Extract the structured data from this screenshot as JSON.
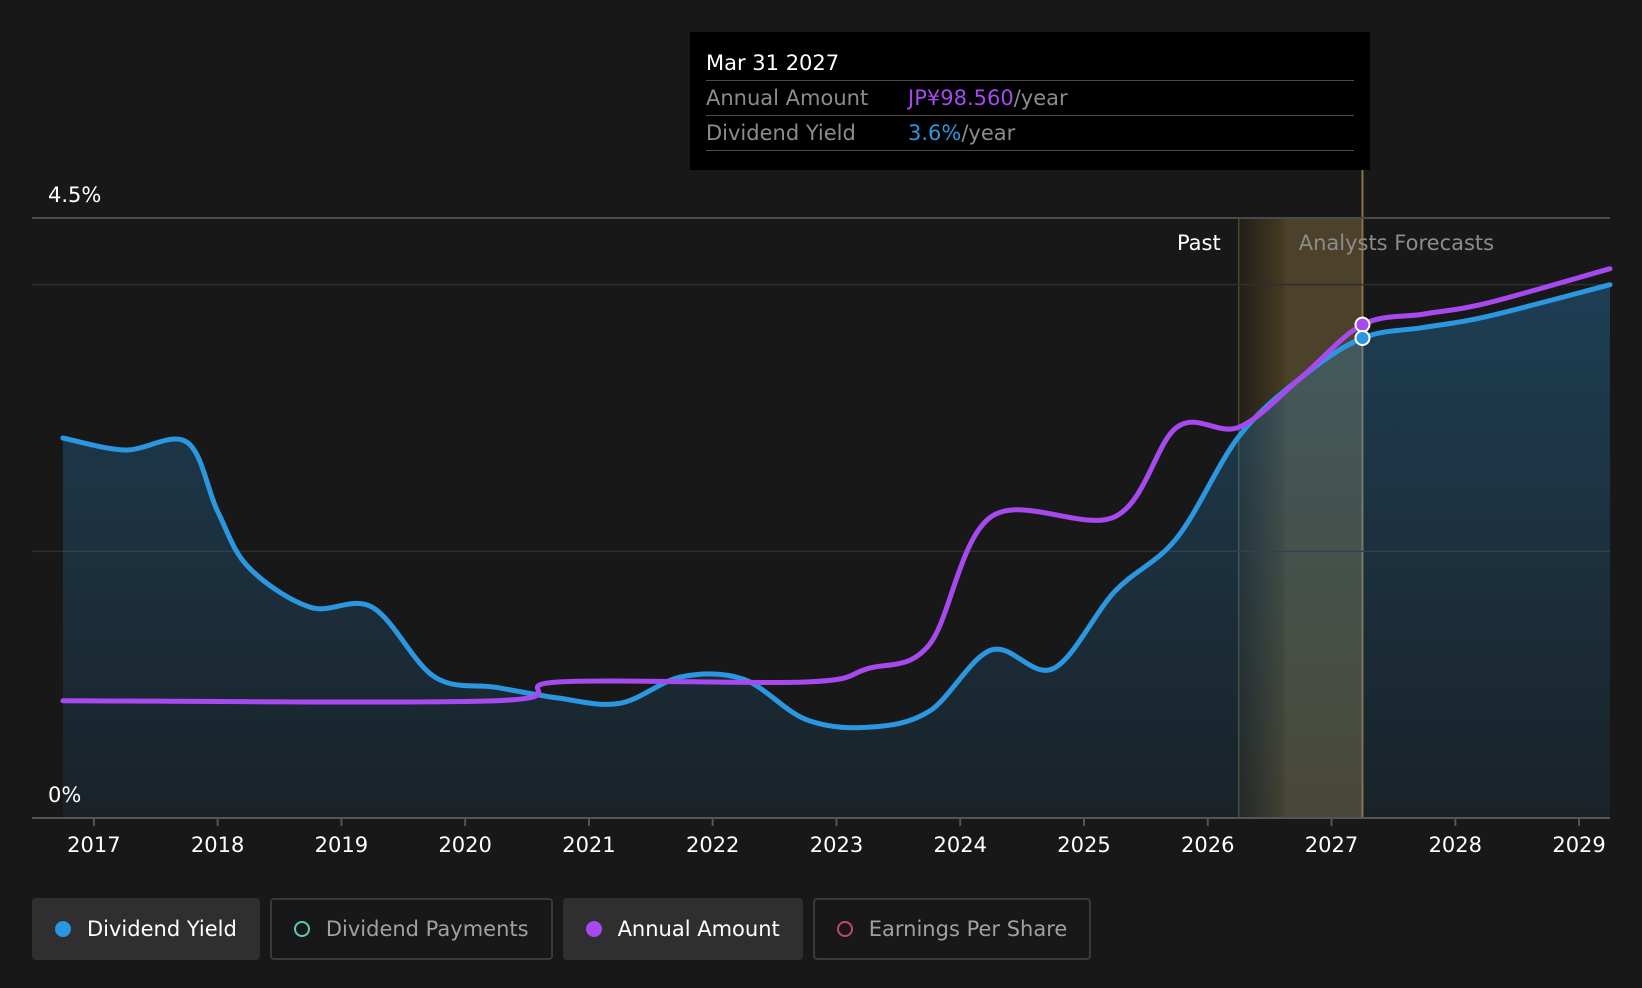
{
  "tooltip": {
    "date": "Mar 31 2027",
    "rows": [
      {
        "label": "Annual Amount",
        "value": "JP¥98.560",
        "unit": "/year",
        "color": "#a64af0"
      },
      {
        "label": "Dividend Yield",
        "value": "3.6%",
        "unit": "/year",
        "color": "#2b97e0"
      }
    ]
  },
  "legend": [
    {
      "label": "Dividend Yield",
      "color": "#2b97e0",
      "filled": true,
      "active": true
    },
    {
      "label": "Dividend Payments",
      "color": "#5fc8b8",
      "filled": false,
      "active": false
    },
    {
      "label": "Annual Amount",
      "color": "#a64af0",
      "filled": true,
      "active": true
    },
    {
      "label": "Earnings Per Share",
      "color": "#c0457a",
      "filled": false,
      "active": false
    }
  ],
  "chart_data": {
    "type": "line",
    "title": "",
    "xlabel": "",
    "ylabel": "",
    "ylim": [
      0,
      4.5
    ],
    "y_tick_labels": [
      "0%",
      "4.5%"
    ],
    "x_tick_labels": [
      "2017",
      "2018",
      "2019",
      "2020",
      "2021",
      "2022",
      "2023",
      "2024",
      "2025",
      "2026",
      "2027",
      "2028",
      "2029"
    ],
    "xlim": [
      2016.5,
      2029.25
    ],
    "past_label": "Past",
    "forecast_label": "Analysts Forecasts",
    "past_band": [
      2026.25,
      2026.62
    ],
    "forecast_band": [
      2026.62,
      2027.25
    ],
    "hover_x": 2027.25,
    "grid": true,
    "legend_placement": "bottom",
    "series": [
      {
        "name": "Dividend Yield",
        "color": "#2b97e0",
        "fill": true,
        "points": [
          [
            2016.75,
            2.85
          ],
          [
            2017.25,
            2.76
          ],
          [
            2017.75,
            2.82
          ],
          [
            2018.0,
            2.3
          ],
          [
            2018.25,
            1.88
          ],
          [
            2018.75,
            1.58
          ],
          [
            2019.25,
            1.58
          ],
          [
            2019.75,
            1.06
          ],
          [
            2020.25,
            0.98
          ],
          [
            2020.75,
            0.9
          ],
          [
            2021.25,
            0.86
          ],
          [
            2021.75,
            1.06
          ],
          [
            2022.25,
            1.04
          ],
          [
            2022.75,
            0.74
          ],
          [
            2023.25,
            0.68
          ],
          [
            2023.75,
            0.8
          ],
          [
            2024.25,
            1.26
          ],
          [
            2024.75,
            1.12
          ],
          [
            2025.25,
            1.7
          ],
          [
            2025.75,
            2.1
          ],
          [
            2026.25,
            2.86
          ],
          [
            2026.75,
            3.3
          ],
          [
            2027.25,
            3.6
          ],
          [
            2027.75,
            3.68
          ],
          [
            2028.25,
            3.76
          ],
          [
            2029.25,
            4.0
          ]
        ]
      },
      {
        "name": "Annual Amount",
        "color": "#a64af0",
        "fill": false,
        "points": [
          [
            2016.75,
            0.88
          ],
          [
            2020.25,
            0.88
          ],
          [
            2020.75,
            1.02
          ],
          [
            2022.75,
            1.02
          ],
          [
            2023.25,
            1.12
          ],
          [
            2023.75,
            1.3
          ],
          [
            2024.25,
            2.26
          ],
          [
            2025.25,
            2.26
          ],
          [
            2025.75,
            2.93
          ],
          [
            2026.25,
            2.93
          ],
          [
            2026.75,
            3.3
          ],
          [
            2027.25,
            3.7
          ],
          [
            2027.75,
            3.78
          ],
          [
            2028.25,
            3.86
          ],
          [
            2029.25,
            4.12
          ]
        ]
      }
    ]
  }
}
